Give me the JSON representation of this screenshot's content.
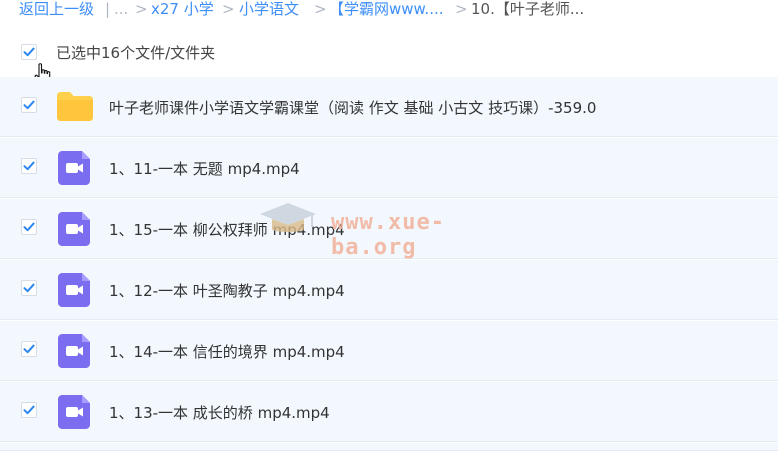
{
  "breadcrumb": {
    "back": "返回上一级",
    "divider": "|",
    "ellipsis": "...",
    "separator": ">",
    "items": [
      "x27 小学",
      "小学语文",
      "【学霸网www....",
      "10.【叶子老师..."
    ]
  },
  "selection": {
    "label": "已选中16个文件/文件夹",
    "checked": true
  },
  "files": [
    {
      "type": "folder",
      "name": "叶子老师课件小学语文学霸课堂（阅读 作文 基础 小古文 技巧课）-359.0",
      "checked": true
    },
    {
      "type": "video",
      "name": "1、11-一本 无题 mp4.mp4",
      "checked": true
    },
    {
      "type": "video",
      "name": "1、15-一本 柳公权拜师 mp4.mp4",
      "checked": true
    },
    {
      "type": "video",
      "name": "1、12-一本 叶圣陶教子 mp4.mp4",
      "checked": true
    },
    {
      "type": "video",
      "name": "1、14-一本 信任的境界 mp4.mp4",
      "checked": true
    },
    {
      "type": "video",
      "name": "1、13-一本 成长的桥 mp4.mp4",
      "checked": true
    }
  ],
  "watermark": {
    "text": "www.xue-ba.org",
    "icon": "graduation-cap-icon"
  },
  "colors": {
    "link": "#3e8ef7",
    "check": "#2b87f0",
    "row_bg": "#f2f8fe",
    "folder": "#ffd04b",
    "video": "#7b6df0"
  }
}
